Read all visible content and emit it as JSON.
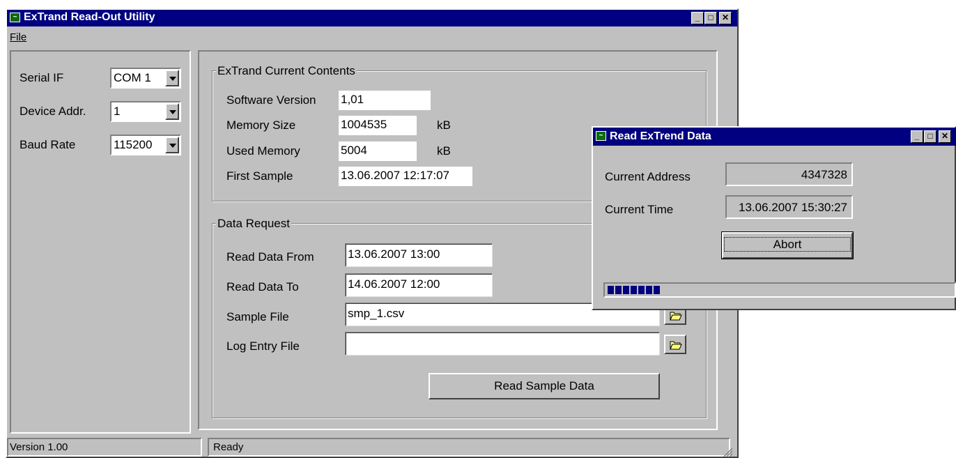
{
  "main_window": {
    "title": "ExTrand Read-Out Utility",
    "menu": {
      "file": "File"
    },
    "settings": {
      "serial_if": {
        "label": "Serial IF",
        "value": "COM 1"
      },
      "device_addr": {
        "label": "Device Addr.",
        "value": "1"
      },
      "baud_rate": {
        "label": "Baud Rate",
        "value": "115200"
      }
    },
    "current_contents": {
      "title": "ExTrand Current Contents",
      "software_version": {
        "label": "Software Version",
        "value": "1,01"
      },
      "memory_size": {
        "label": "Memory Size",
        "value": "1004535",
        "unit": "kB"
      },
      "used_memory": {
        "label": "Used Memory",
        "value": "5004",
        "unit": "kB"
      },
      "first_sample": {
        "label": "First Sample",
        "value": "13.06.2007 12:17:07"
      }
    },
    "data_request": {
      "title": "Data Request",
      "read_from": {
        "label": "Read Data From",
        "value": "13.06.2007 13:00"
      },
      "read_to": {
        "label": "Read Data To",
        "value": "14.06.2007 12:00"
      },
      "sample_file": {
        "label": "Sample File",
        "value": "smp_1.csv"
      },
      "log_file": {
        "label": "Log Entry File",
        "value": ""
      },
      "read_button": "Read Sample Data"
    },
    "status": {
      "version": "Version 1.00",
      "state": "Ready"
    }
  },
  "dialog": {
    "title": "Read ExTrend Data",
    "current_address": {
      "label": "Current Address",
      "value": "4347328"
    },
    "current_time": {
      "label": "Current Time",
      "value": "13.06.2007 15:30:27"
    },
    "abort_button": "Abort",
    "progress": 0.17
  },
  "colors": {
    "titlebar": "#000080",
    "face": "#c0c0c0",
    "progress": "#000080"
  }
}
